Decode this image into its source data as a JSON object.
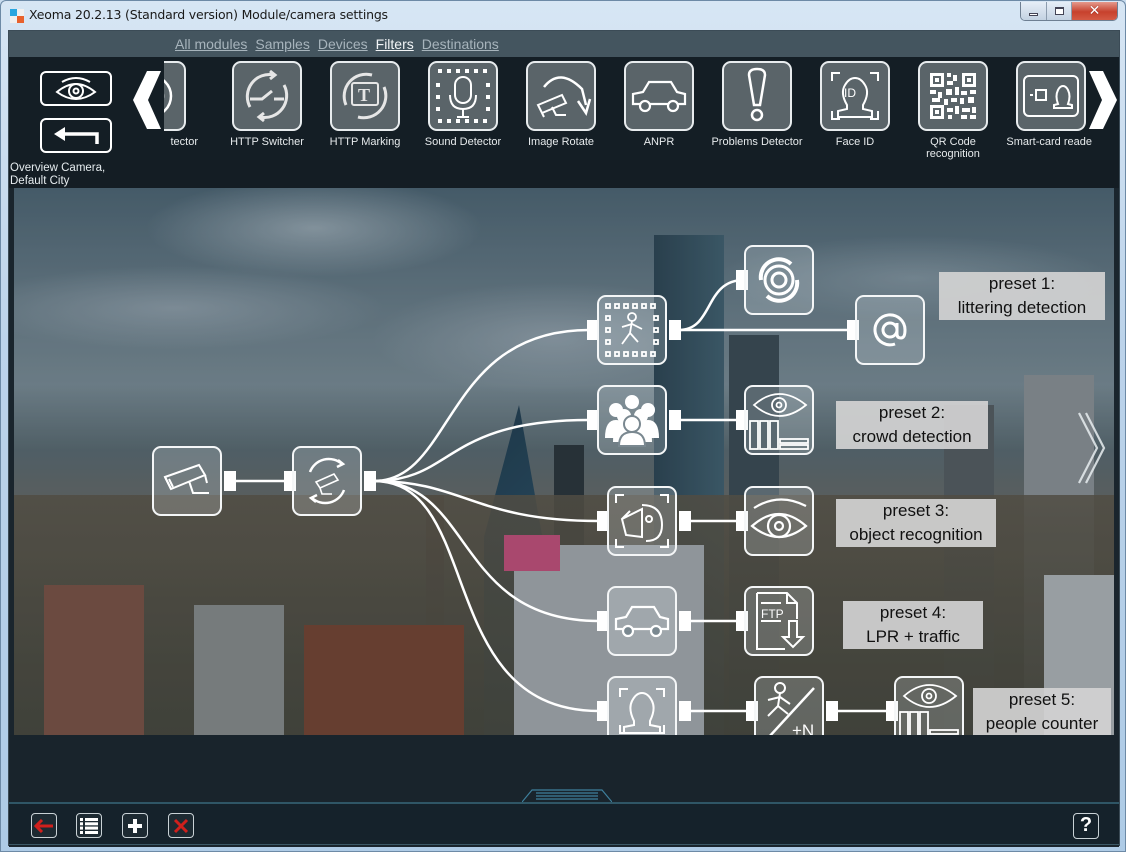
{
  "window": {
    "title": "Xeoma 20.2.13 (Standard version) Module/camera settings",
    "controls": [
      "minimize",
      "maximize",
      "close"
    ]
  },
  "tabs": [
    {
      "label": "All modules",
      "active": false
    },
    {
      "label": "Samples",
      "active": false
    },
    {
      "label": "Devices",
      "active": false
    },
    {
      "label": "Filters",
      "active": true
    },
    {
      "label": "Destinations",
      "active": false
    }
  ],
  "sidebar": {
    "preview_icon": "eye-icon",
    "back_icon": "return-arrow-icon",
    "camera_label": "Overview Camera, Default City"
  },
  "module_strip": {
    "prev_icon": "chevron-left-icon",
    "next_icon": "chevron-right-icon",
    "modules": [
      {
        "label": "tector",
        "icon": "motion-detector-icon"
      },
      {
        "label": "HTTP Switcher",
        "icon": "http-switcher-icon"
      },
      {
        "label": "HTTP Marking",
        "icon": "http-marking-icon"
      },
      {
        "label": "Sound Detector",
        "icon": "microphone-icon"
      },
      {
        "label": "Image Rotate",
        "icon": "rotate-camera-icon"
      },
      {
        "label": "ANPR",
        "icon": "car-icon"
      },
      {
        "label": "Problems Detector",
        "icon": "exclamation-icon"
      },
      {
        "label": "Face ID",
        "icon": "face-id-icon"
      },
      {
        "label": "QR Code recognition",
        "icon": "qr-code-icon"
      },
      {
        "label": "Smart-card reader",
        "icon": "smart-card-icon"
      }
    ]
  },
  "chain": {
    "source": {
      "icon": "camera-icon"
    },
    "scheduler": {
      "icon": "camera-rotate-icon"
    },
    "presets": [
      {
        "label_line1": "preset 1:",
        "label_line2": "littering detection",
        "nodes": [
          "motion-detector-icon",
          "archive-icon",
          "email-icon"
        ]
      },
      {
        "label_line1": "preset 2:",
        "label_line2": "crowd detection",
        "nodes": [
          "crowd-icon",
          "eye-report-icon"
        ]
      },
      {
        "label_line1": "preset 3:",
        "label_line2": "object recognition",
        "nodes": [
          "object-recognition-icon",
          "eye-icon"
        ]
      },
      {
        "label_line1": "preset 4:",
        "label_line2": "LPR + traffic",
        "nodes": [
          "car-icon",
          "ftp-upload-icon"
        ]
      },
      {
        "label_line1": "preset 5:",
        "label_line2": "people counter",
        "nodes": [
          "face-frame-icon",
          "people-counter-icon",
          "eye-report-icon"
        ]
      }
    ]
  },
  "footer": {
    "buttons": [
      {
        "name": "back",
        "icon": "red-arrow-left-icon"
      },
      {
        "name": "list",
        "icon": "list-icon"
      },
      {
        "name": "add",
        "icon": "plus-icon"
      },
      {
        "name": "delete",
        "icon": "red-x-icon"
      }
    ],
    "help_label": "?"
  },
  "colors": {
    "panel_bg": "#1a252d",
    "tabs_bar": "#44555f",
    "footer_accent": "#2f5666",
    "danger": "#d0201c"
  }
}
